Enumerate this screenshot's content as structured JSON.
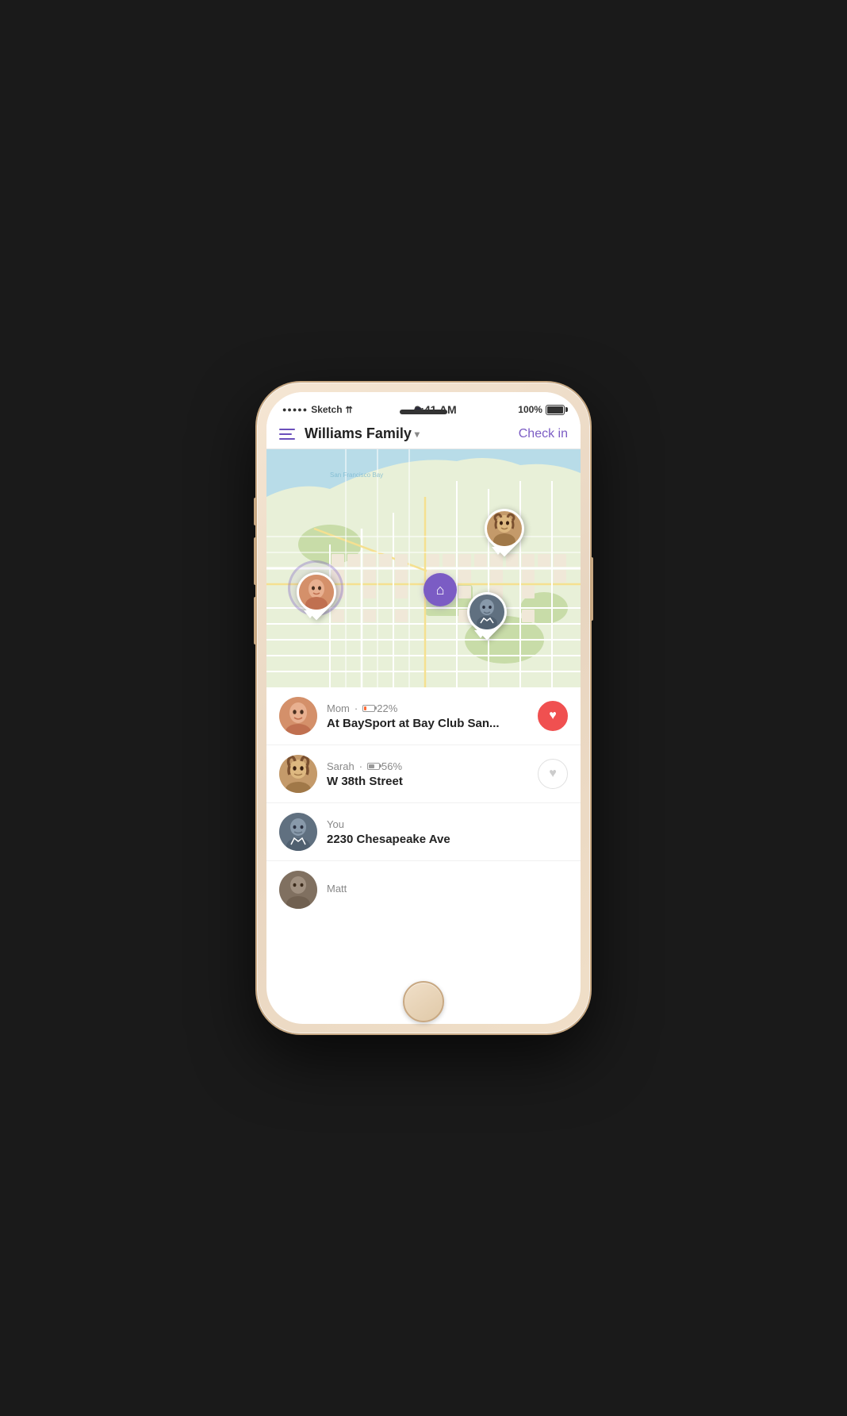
{
  "device": {
    "speaker_visible": true,
    "camera_visible": true
  },
  "status_bar": {
    "carrier": "Sketch",
    "wifi": "wifi",
    "time": "9:41 AM",
    "battery_percent": "100%",
    "signal_dots": "●●●●●"
  },
  "nav": {
    "title": "Williams Family",
    "dropdown_arrow": "▾",
    "check_in_label": "Check in"
  },
  "map": {
    "home_pin_icon": "⌂"
  },
  "members": [
    {
      "id": "mom",
      "name": "Mom",
      "battery_pct": "22%",
      "battery_level": 22,
      "location": "At BaySport at Bay Club San...",
      "heart_active": true,
      "face_color_top": "#e8b090",
      "face_color_bot": "#c98060"
    },
    {
      "id": "sarah",
      "name": "Sarah",
      "battery_pct": "56%",
      "battery_level": 56,
      "location": "W 38th Street",
      "heart_active": false,
      "face_color_top": "#b8d4a0",
      "face_color_bot": "#90b878"
    },
    {
      "id": "you",
      "name": "You",
      "battery_pct": null,
      "battery_level": null,
      "location": "2230 Chesapeake Ave",
      "heart_active": false,
      "face_color_top": "#8090a8",
      "face_color_bot": "#607090"
    },
    {
      "id": "matt",
      "name": "Matt",
      "battery_pct": null,
      "battery_level": null,
      "location": "",
      "heart_active": false,
      "face_color_top": "#a09080",
      "face_color_bot": "#807060"
    }
  ],
  "colors": {
    "accent_purple": "#7b5cc4",
    "heart_red": "#f05050",
    "border_light": "#f0f0f0",
    "text_dark": "#222",
    "text_muted": "#888"
  }
}
